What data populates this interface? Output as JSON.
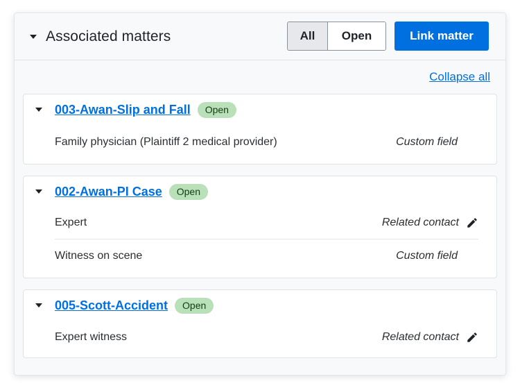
{
  "header": {
    "title": "Associated matters",
    "filter_all": "All",
    "filter_open": "Open",
    "link_button": "Link matter"
  },
  "collapse_all": "Collapse all",
  "matters": [
    {
      "name": "003-Awan-Slip and Fall",
      "status": "Open",
      "rows": [
        {
          "label": "Family physician (Plaintiff 2 medical provider)",
          "type": "Custom field",
          "editable": false
        }
      ]
    },
    {
      "name": "002-Awan-PI Case",
      "status": "Open",
      "rows": [
        {
          "label": "Expert",
          "type": "Related contact",
          "editable": true
        },
        {
          "label": "Witness on scene",
          "type": "Custom field",
          "editable": false
        }
      ]
    },
    {
      "name": "005-Scott-Accident",
      "status": "Open",
      "rows": [
        {
          "label": "Expert witness",
          "type": "Related contact",
          "editable": true
        }
      ]
    }
  ],
  "icons": {
    "caret": "caret-down-icon",
    "edit": "pencil-icon"
  },
  "colors": {
    "primary": "#0070e0",
    "badge_bg": "#b9e0b8",
    "badge_text": "#123d12"
  }
}
